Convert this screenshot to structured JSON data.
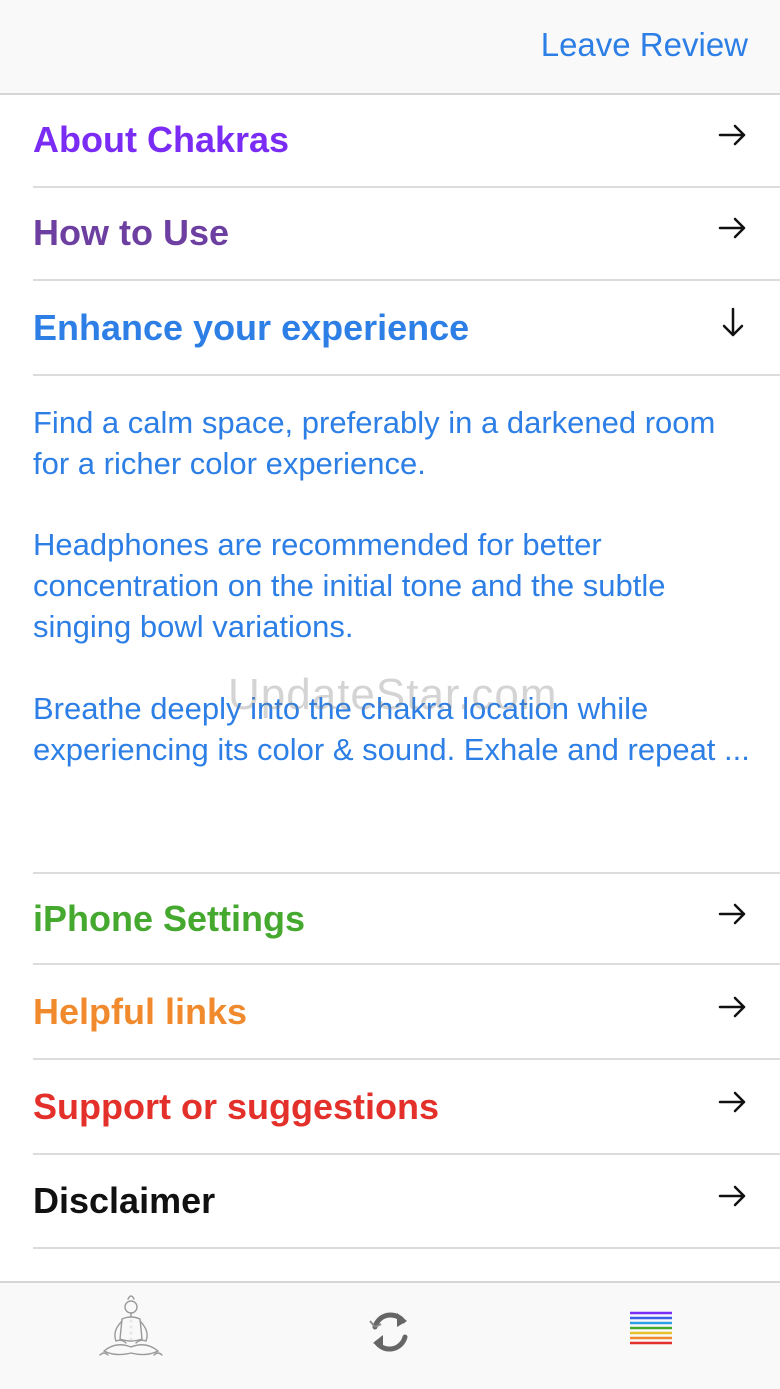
{
  "header": {
    "leave_review": "Leave Review"
  },
  "menu": [
    {
      "label": "About Chakras",
      "color": "#7a2cf5",
      "arrow": "right-arrow-icon"
    },
    {
      "label": "How to Use",
      "color": "#6d3fa0",
      "arrow": "right-arrow-icon"
    },
    {
      "label": "Enhance your experience",
      "color": "#2d7fe6",
      "arrow": "down-arrow-icon"
    },
    {
      "label": "iPhone Settings",
      "color": "#45a82f",
      "arrow": "right-arrow-icon"
    },
    {
      "label": "Helpful links",
      "color": "#f08a2c",
      "arrow": "right-arrow-icon"
    },
    {
      "label": "Support or suggestions",
      "color": "#e4302a",
      "arrow": "right-arrow-icon"
    },
    {
      "label": "Disclaimer",
      "color": "#111111",
      "arrow": "right-arrow-icon"
    }
  ],
  "enhance_content": {
    "paragraphs": [
      "Find a calm space, preferably in a darkened room for a richer color experience.",
      "Headphones are recommended for better concentration on the initial tone and the subtle singing bowl variations.",
      "Breathe deeply into the chakra location while experiencing its color & sound. Exhale and repeat ..."
    ],
    "text_color": "#2d7fe6"
  },
  "watermark": "UpdateStar.com",
  "tabbar": {
    "tabs": [
      {
        "icon": "meditation-figure-icon"
      },
      {
        "icon": "refresh-icon"
      },
      {
        "icon": "rainbow-lines-icon"
      }
    ],
    "rainbow_colors": [
      "#7a2cf5",
      "#3b5fe6",
      "#2d9fe6",
      "#45a82f",
      "#e6c22c",
      "#f08a2c",
      "#e4302a"
    ]
  }
}
